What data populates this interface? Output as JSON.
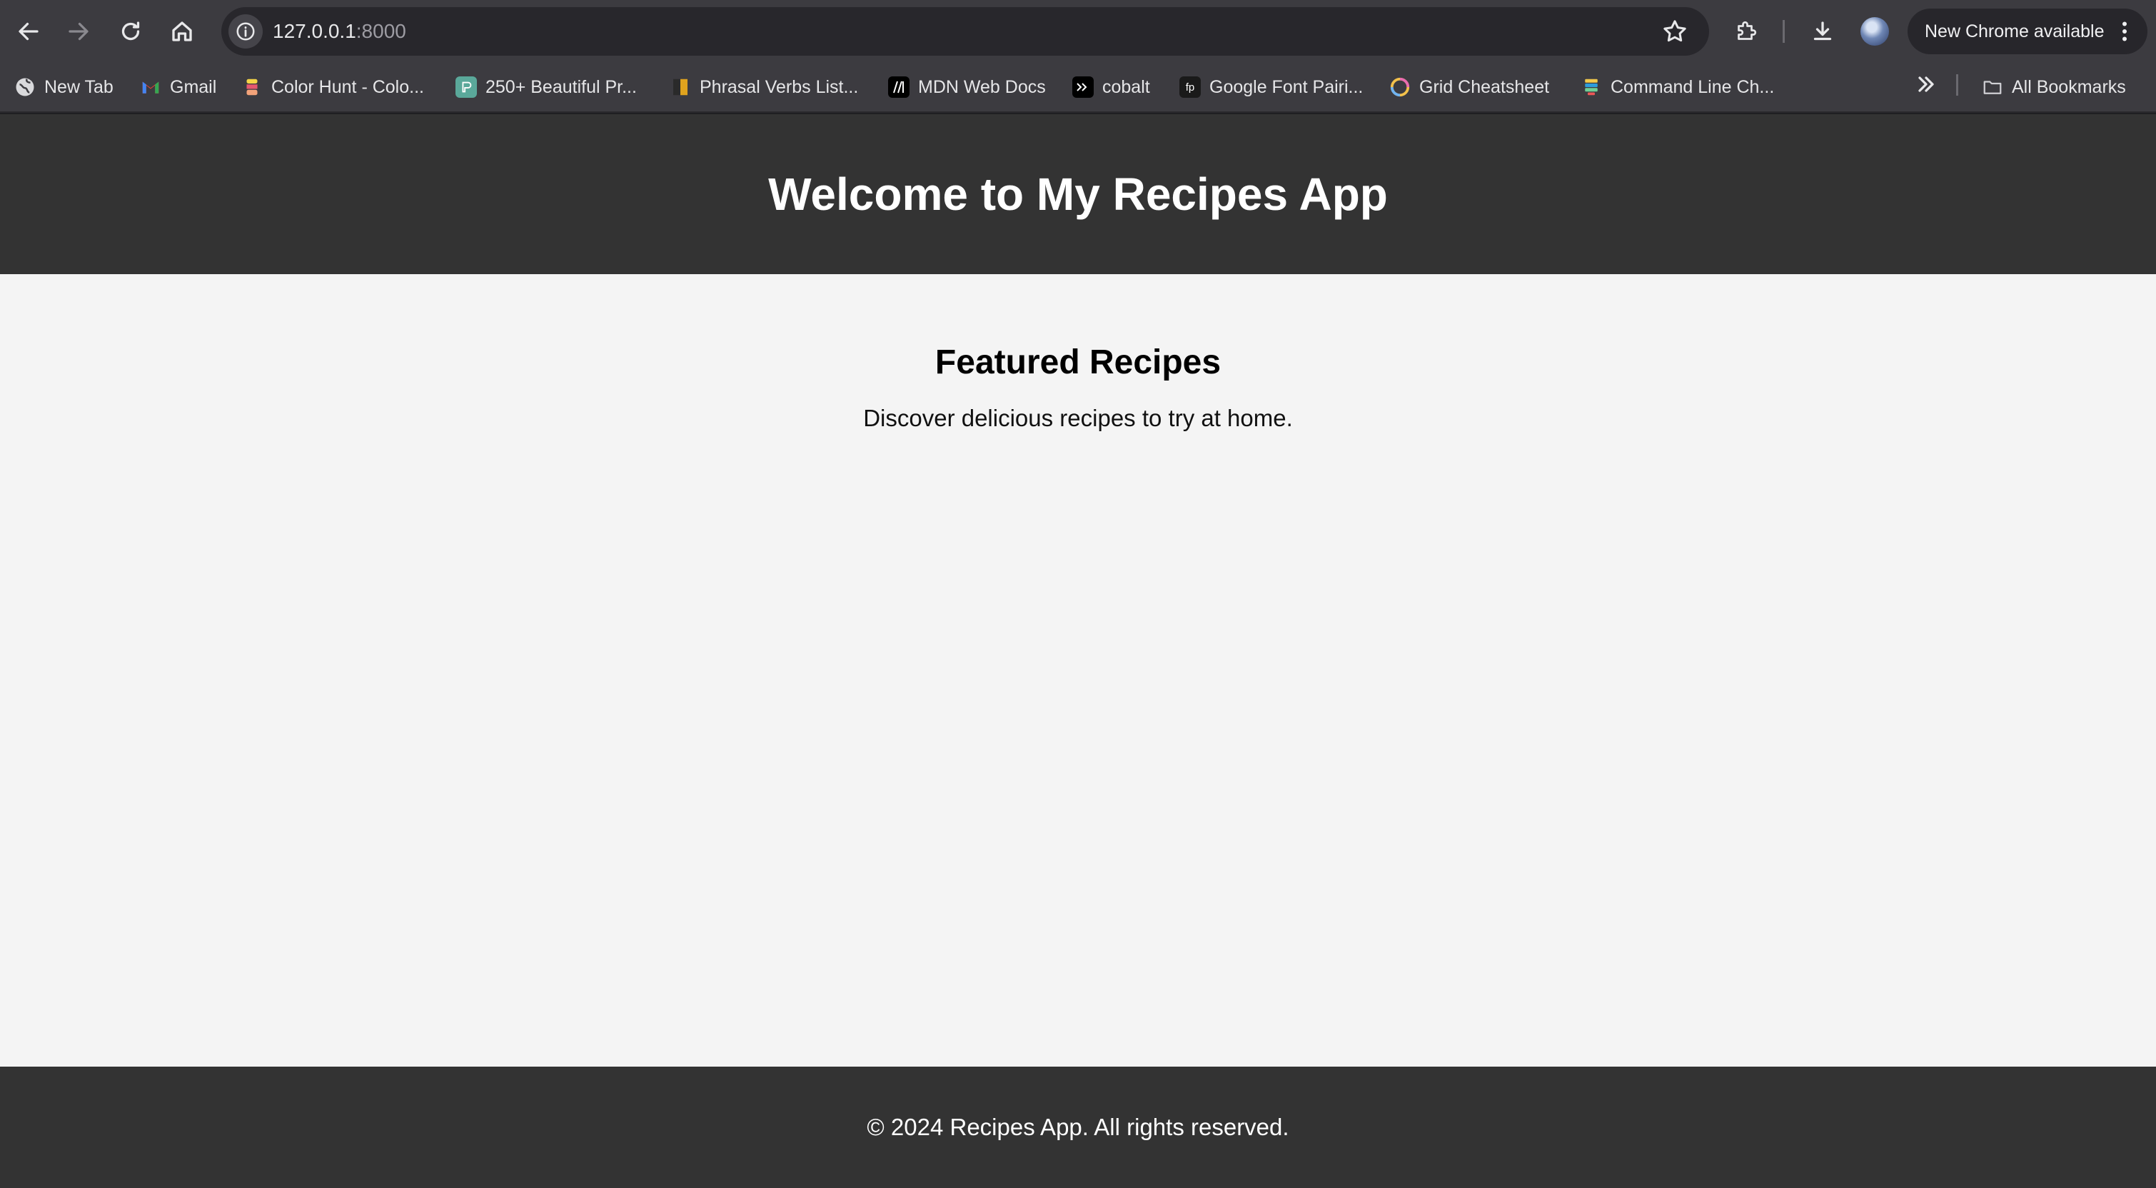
{
  "browser": {
    "url_host": "127.0.0.1",
    "url_port": ":8000",
    "update_label": "New Chrome available",
    "icons": {
      "back": "arrow-left-icon",
      "forward": "arrow-right-icon",
      "reload": "reload-icon",
      "home": "home-icon",
      "site_info": "info-icon",
      "bookmark_star": "star-icon",
      "extensions": "puzzle-icon",
      "downloads": "download-icon",
      "profile": "avatar",
      "menu": "kebab-menu-icon"
    }
  },
  "bookmarks": {
    "items": [
      {
        "label": "New Tab",
        "icon": "globe-icon"
      },
      {
        "label": "Gmail",
        "icon": "gmail-icon"
      },
      {
        "label": "Color Hunt - Colo...",
        "icon": "colorhunt-icon"
      },
      {
        "label": "250+ Beautiful Pr...",
        "icon": "palette-icon"
      },
      {
        "label": "Phrasal Verbs List...",
        "icon": "book-icon"
      },
      {
        "label": "MDN Web Docs",
        "icon": "mdn-icon"
      },
      {
        "label": "cobalt",
        "icon": "terminal-icon"
      },
      {
        "label": "Google Font Pairi...",
        "icon": "fontpair-icon"
      },
      {
        "label": "Grid Cheatsheet",
        "icon": "ring-icon"
      },
      {
        "label": "Command Line Ch...",
        "icon": "cli-icon"
      }
    ],
    "all_bookmarks_label": "All Bookmarks"
  },
  "page": {
    "header_title": "Welcome to My Recipes App",
    "featured_heading": "Featured Recipes",
    "featured_text": "Discover delicious recipes to try at home.",
    "footer_text": "© 2024 Recipes App. All rights reserved."
  },
  "colors": {
    "toolbar_bg": "#3c3b40",
    "omnibox_bg": "#28272c",
    "header_bg": "#333333",
    "page_bg": "#f4f4f4",
    "footer_bg": "#333333"
  }
}
